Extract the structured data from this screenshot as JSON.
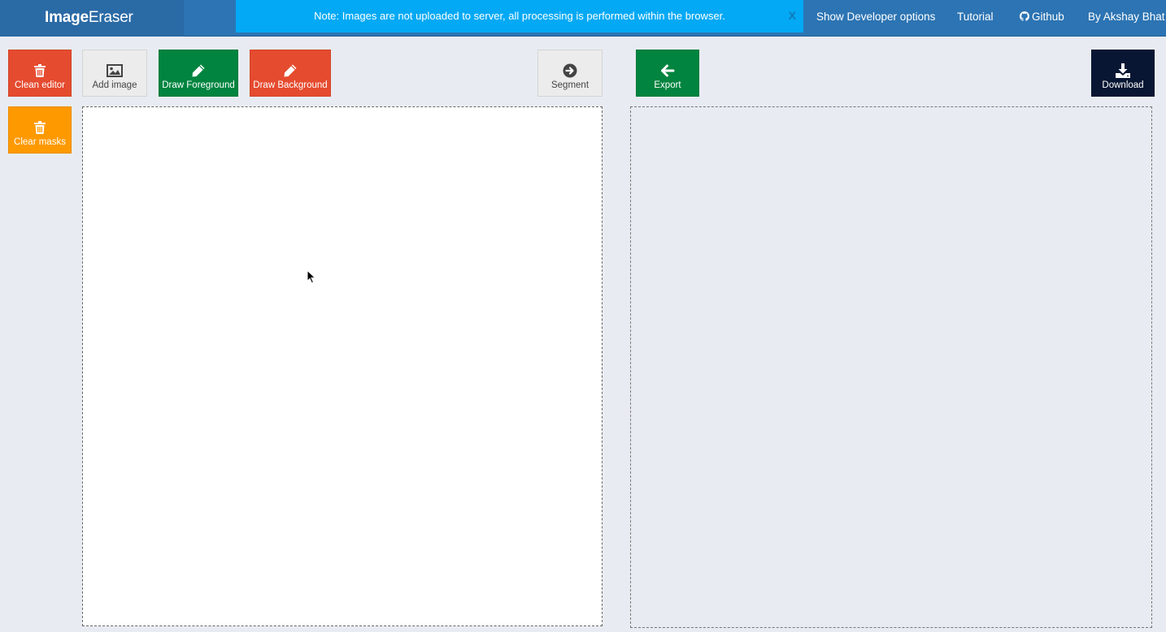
{
  "header": {
    "brand_part1": "Image",
    "brand_part2": "Eraser",
    "notice": "Note: Images are not uploaded to server, all processing is performed within the browser.",
    "notice_close": "X",
    "nav": {
      "developer": "Show Developer options",
      "tutorial": "Tutorial",
      "github": "Github",
      "author": "By Akshay Bhat"
    }
  },
  "toolbar": {
    "clean_editor": "Clean editor",
    "add_image": "Add image",
    "draw_foreground": "Draw Foreground",
    "draw_background": "Draw Background",
    "segment": "Segment",
    "export": "Export",
    "download": "Download",
    "clear_masks": "Clear masks"
  },
  "icons": {
    "clean_editor": "trash-icon",
    "add_image": "image-icon",
    "draw_foreground": "pencil-icon",
    "draw_background": "pencil-icon",
    "segment": "arrow-circle-right-icon",
    "export": "arrow-left-icon",
    "download": "download-icon",
    "clear_masks": "trash-icon",
    "github": "github-icon"
  },
  "colors": {
    "topbar": "#2c74b3",
    "notice": "#03a9f4",
    "red": "#e54b2f",
    "green": "#00843f",
    "orange": "#ff9900",
    "navy": "#081633",
    "gray": "#ececec"
  }
}
